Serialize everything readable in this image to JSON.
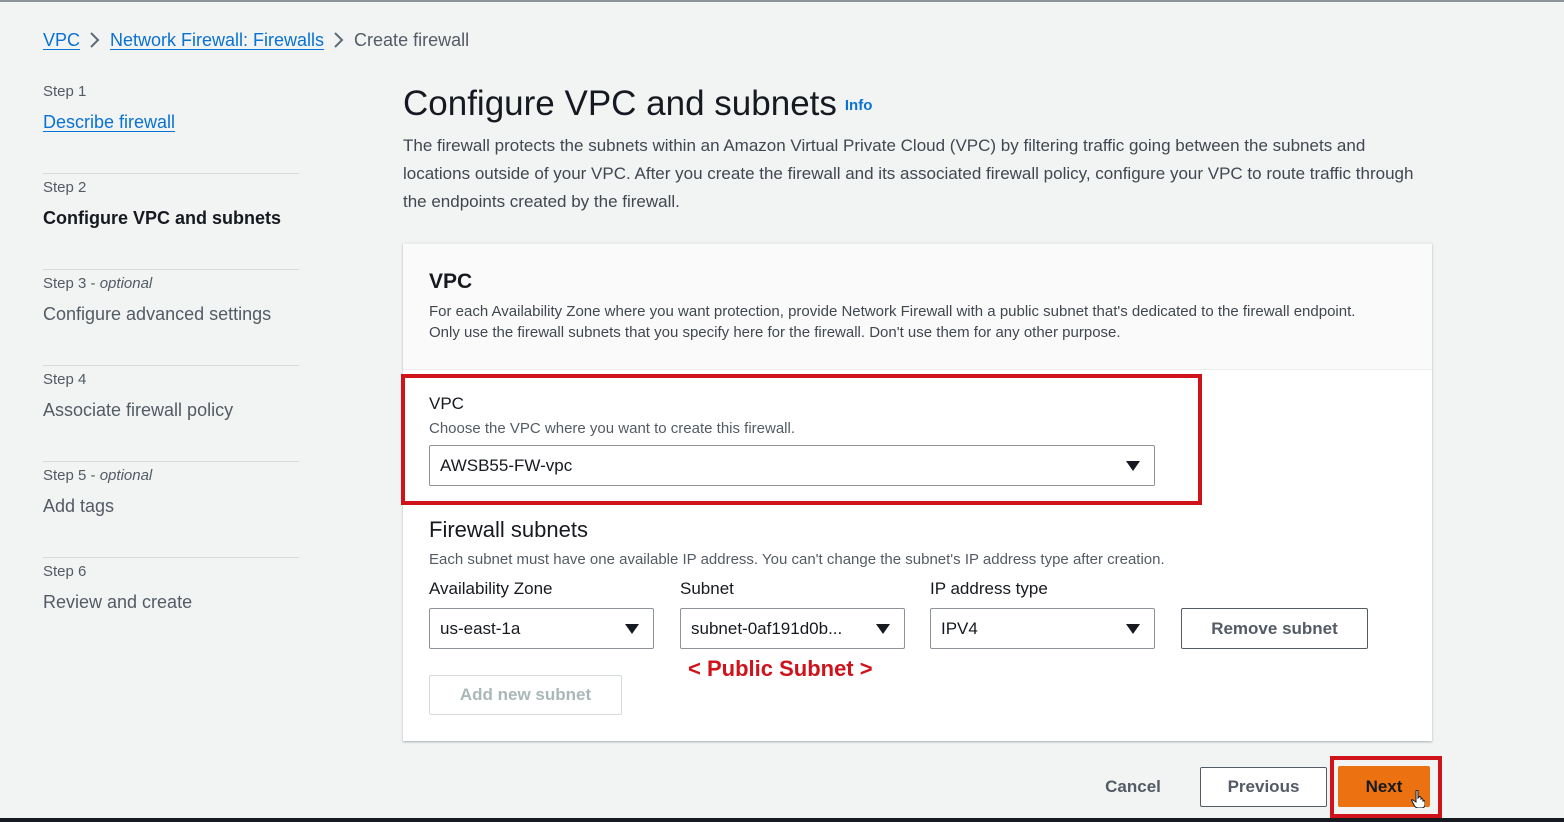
{
  "breadcrumb": {
    "items": [
      {
        "label": "VPC"
      },
      {
        "label": "Network Firewall: Firewalls"
      },
      {
        "label": "Create firewall"
      }
    ]
  },
  "steps": [
    {
      "number": "Step 1",
      "optional": "",
      "title": "Describe firewall",
      "state": "link"
    },
    {
      "number": "Step 2",
      "optional": "",
      "title": "Configure VPC and subnets",
      "state": "current"
    },
    {
      "number": "Step 3",
      "optional": "optional",
      "title": "Configure advanced settings",
      "state": "disabled"
    },
    {
      "number": "Step 4",
      "optional": "",
      "title": "Associate firewall policy",
      "state": "disabled"
    },
    {
      "number": "Step 5",
      "optional": "optional",
      "title": "Add tags",
      "state": "disabled"
    },
    {
      "number": "Step 6",
      "optional": "",
      "title": "Review and create",
      "state": "disabled"
    }
  ],
  "page": {
    "title": "Configure VPC and subnets",
    "info_link": "Info",
    "description": "The firewall protects the subnets within an Amazon Virtual Private Cloud (VPC) by filtering traffic going between the subnets and locations outside of your VPC. After you create the firewall and its associated firewall policy, configure your VPC to route traffic through the endpoints created by the firewall."
  },
  "vpc_section": {
    "title": "VPC",
    "description": "For each Availability Zone where you want protection, provide Network Firewall with a public subnet that's dedicated to the firewall endpoint. Only use the firewall subnets that you specify here for the firewall. Don't use them for any other purpose.",
    "vpc_field": {
      "label": "VPC",
      "description": "Choose the VPC where you want to create this firewall.",
      "value": "AWSB55-FW-vpc"
    }
  },
  "firewall_subnets": {
    "title": "Firewall subnets",
    "description": "Each subnet must have one available IP address. You can't change the subnet's IP address type after creation.",
    "az_label": "Availability Zone",
    "subnet_label": "Subnet",
    "ip_type_label": "IP address type",
    "rows": [
      {
        "az": "us-east-1a",
        "subnet": "subnet-0af191d0b...",
        "ip_type": "IPV4",
        "remove_label": "Remove subnet"
      }
    ],
    "add_label": "Add new subnet",
    "annotation": "< Public Subnet >"
  },
  "footer": {
    "cancel_label": "Cancel",
    "previous_label": "Previous",
    "next_label": "Next"
  },
  "colors": {
    "link": "#0972d3",
    "primary_button": "#ec7211",
    "annotation": "#d0121b",
    "background": "#f2f3f3"
  },
  "icons": {
    "breadcrumb_separator": "chevron-right-icon",
    "select_caret": "caret-down-icon",
    "cursor": "hand-pointer-icon"
  }
}
